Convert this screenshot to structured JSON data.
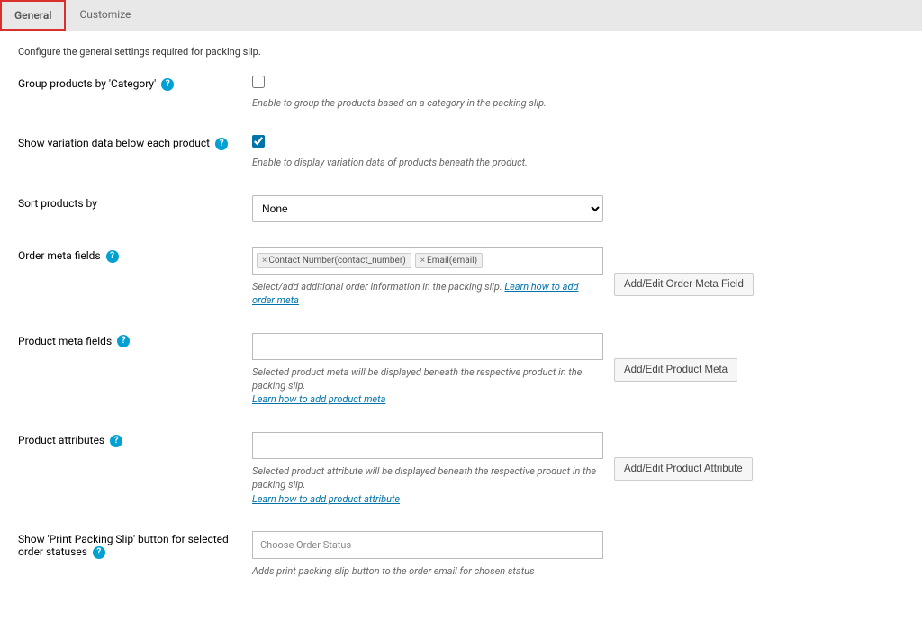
{
  "tabs": {
    "general": "General",
    "customize": "Customize"
  },
  "intro": "Configure the general settings required for packing slip.",
  "group": {
    "label": "Group products by 'Category'",
    "desc": "Enable to group the products based on a category in the packing slip."
  },
  "variation": {
    "label": "Show variation data below each product",
    "desc": "Enable to display variation data of products beneath the product."
  },
  "sort": {
    "label": "Sort products by",
    "selected": "None"
  },
  "ordermeta": {
    "label": "Order meta fields",
    "tag1": "Contact Number(contact_number)",
    "tag2": "Email(email)",
    "desc_prefix": "Select/add additional order information in the packing slip. ",
    "link": "Learn how to add order meta",
    "button": "Add/Edit Order Meta Field"
  },
  "productmeta": {
    "label": "Product meta fields",
    "desc": "Selected product meta will be displayed beneath the respective product in the packing slip.",
    "link": "Learn how to add product meta",
    "button": "Add/Edit Product Meta"
  },
  "productattr": {
    "label": "Product attributes",
    "desc": "Selected product attribute will be displayed beneath the respective product in the packing slip.",
    "link": "Learn how to add product attribute",
    "button": "Add/Edit Product Attribute"
  },
  "printbtn": {
    "label": "Show 'Print Packing Slip' button for selected order statuses",
    "placeholder": "Choose Order Status",
    "desc": "Adds print packing slip button to the order email for chosen status"
  }
}
